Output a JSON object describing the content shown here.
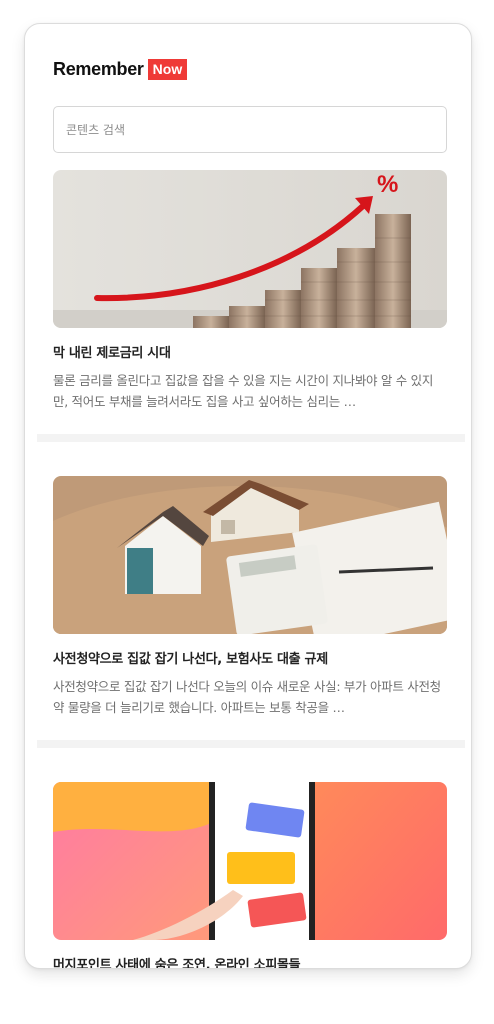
{
  "brand": {
    "name": "Remember",
    "badge": "Now"
  },
  "search": {
    "placeholder": "콘텐츠 검색"
  },
  "articles": [
    {
      "title": "막 내린 제로금리 시대",
      "summary": "물론 금리를 올린다고 집값을 잡을 수 있을 지는 시간이 지나봐야 알 수 있지만, 적어도 부채를 늘려서라도 집을 사고 싶어하는 심리는 …",
      "image": "rising-coins-percent-image"
    },
    {
      "title": "사전청약으로 집값 잡기 나선다, 보험사도 대출 규제",
      "summary": "사전청약으로 집값 잡기 나선다 오늘의 이슈 새로운 사실: 부가 아파트 사전청약 물량을 더 늘리기로 했습니다. 아파트는 보통 착공을 …",
      "image": "house-models-calculator-image"
    },
    {
      "title": "머지포인트 사태에 숨은 조연, 온라인 소피몰들",
      "summary": "",
      "image": "finger-cards-phone-image"
    }
  ],
  "colors": {
    "brand_red": "#ef3a37"
  }
}
